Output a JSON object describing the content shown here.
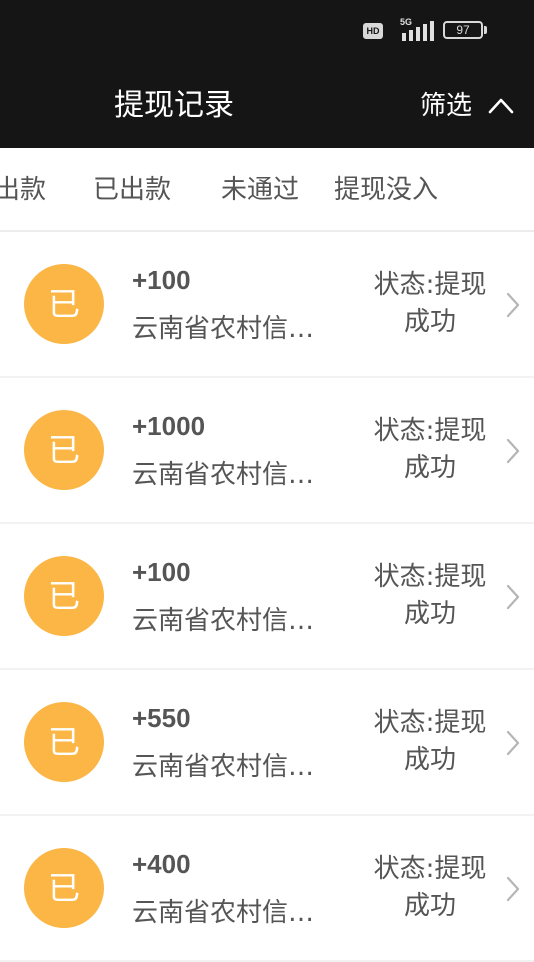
{
  "status_bar": {
    "hd": "HD",
    "network": "5G",
    "battery": "97"
  },
  "header": {
    "title": "提现记录",
    "filter_label": "筛选"
  },
  "tabs": [
    {
      "label": "出款"
    },
    {
      "label": "已出款"
    },
    {
      "label": "未通过"
    },
    {
      "label": "提现没入"
    }
  ],
  "records": [
    {
      "avatar": "已",
      "amount": "+100",
      "bank": "云南省农村信…",
      "status": "状态:提现成功"
    },
    {
      "avatar": "已",
      "amount": "+1000",
      "bank": "云南省农村信…",
      "status": "状态:提现成功"
    },
    {
      "avatar": "已",
      "amount": "+100",
      "bank": "云南省农村信…",
      "status": "状态:提现成功"
    },
    {
      "avatar": "已",
      "amount": "+550",
      "bank": "云南省农村信…",
      "status": "状态:提现成功"
    },
    {
      "avatar": "已",
      "amount": "+400",
      "bank": "云南省农村信…",
      "status": "状态:提现成功"
    }
  ],
  "colors": {
    "header_bg": "#151515",
    "avatar": "#fbb645",
    "text": "#555555"
  }
}
